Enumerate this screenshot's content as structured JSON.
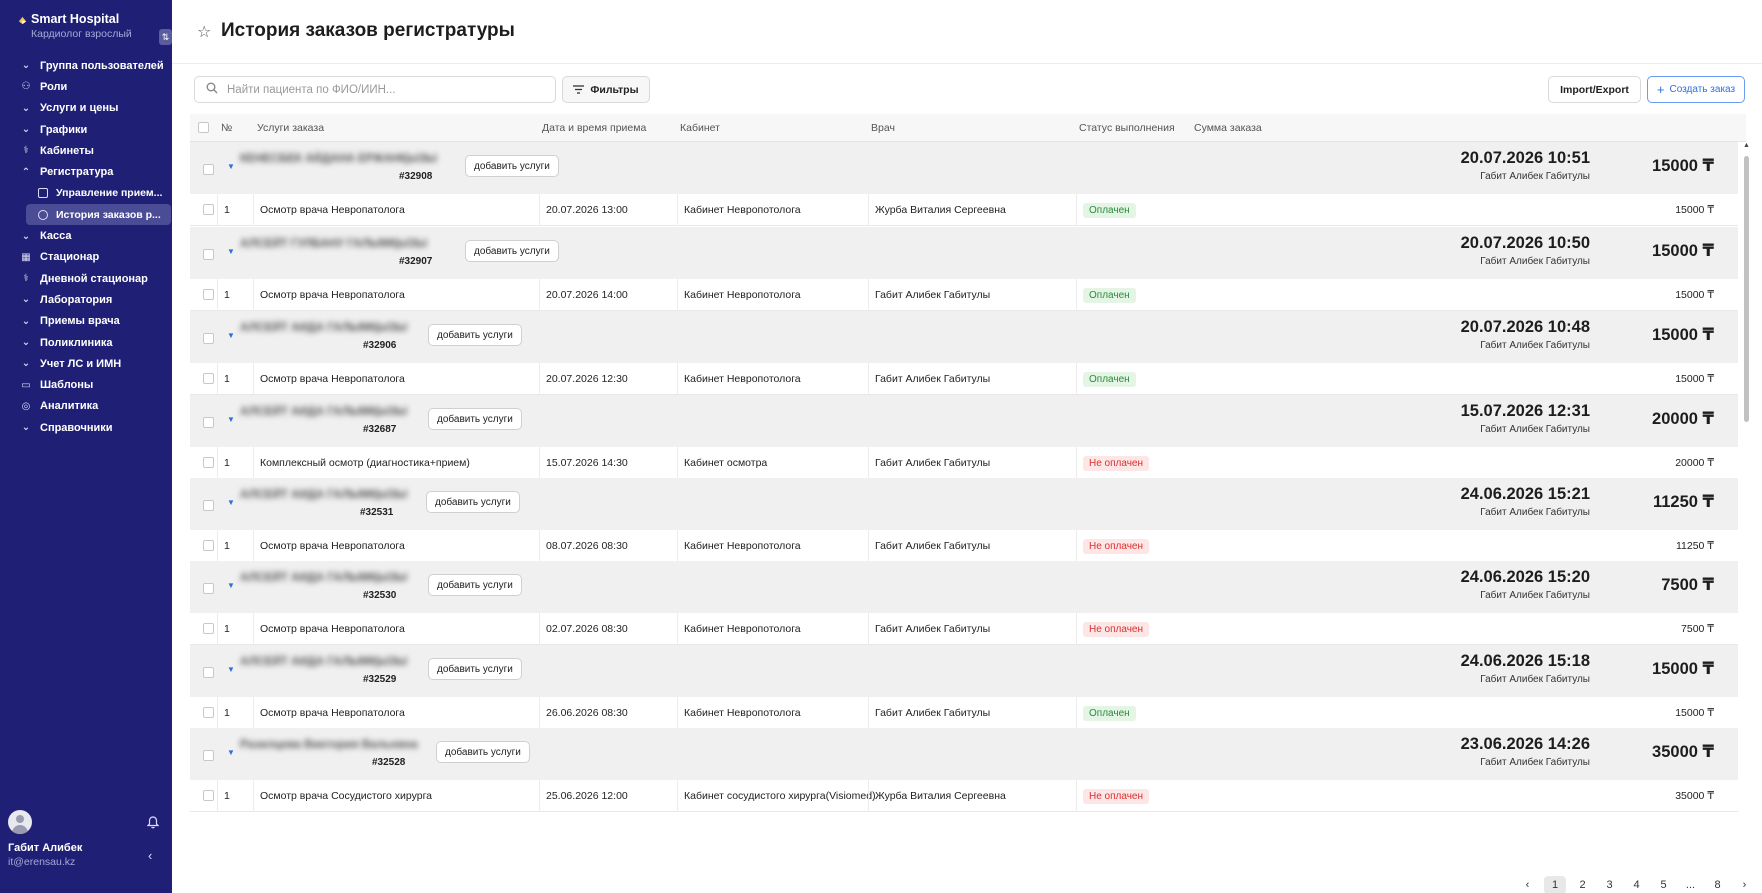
{
  "app": {
    "name": "Smart Hospital",
    "role": "Кардиолог взрослый"
  },
  "sidebar": {
    "items": [
      {
        "label": "Группа пользователей",
        "icon": "chevron-down-icon"
      },
      {
        "label": "Роли",
        "icon": "users-icon"
      },
      {
        "label": "Услуги и цены",
        "icon": "chevron-down-icon"
      },
      {
        "label": "Графики",
        "icon": "chevron-down-icon"
      },
      {
        "label": "Кабинеты",
        "icon": "stethoscope-icon"
      },
      {
        "label": "Регистратура",
        "icon": "chevron-up-icon"
      }
    ],
    "subitems": [
      {
        "label": "Управление прием...",
        "icon": "square-icon"
      },
      {
        "label": "История заказов р...",
        "icon": "circle-icon"
      }
    ],
    "items_after": [
      {
        "label": "Касса",
        "icon": "chevron-down-icon"
      },
      {
        "label": "Стационар",
        "icon": "building-icon"
      },
      {
        "label": "Дневной стационар",
        "icon": "stethoscope-icon"
      },
      {
        "label": "Лаборатория",
        "icon": "chevron-down-icon"
      },
      {
        "label": "Приемы врача",
        "icon": "chevron-down-icon"
      },
      {
        "label": "Поликлиника",
        "icon": "chevron-down-icon"
      },
      {
        "label": "Учет ЛС и ИМН",
        "icon": "chevron-down-icon"
      },
      {
        "label": "Шаблоны",
        "icon": "folder-icon"
      },
      {
        "label": "Аналитика",
        "icon": "chart-icon"
      },
      {
        "label": "Справочники",
        "icon": "chevron-down-icon"
      }
    ]
  },
  "user": {
    "name": "Габит Алибек",
    "email": "it@erensau.kz"
  },
  "header": {
    "title": "История заказов регистратуры"
  },
  "toolbar": {
    "search_placeholder": "Найти пациента по ФИО/ИИН...",
    "filters_label": "Фильтры",
    "import_label": "Import/Export",
    "create_label": "Создать заказ"
  },
  "table": {
    "columns": [
      "№",
      "Услуги заказа",
      "Дата и время приема",
      "Кабинет",
      "Врач",
      "Статус выполнения",
      "Сумма заказа"
    ],
    "add_services_label": "добавить услуги",
    "orders": [
      {
        "patient": "КЕНЕСБЕК АЙДАНА ЕРЖАНҚЫЗЫ",
        "number": "#32908",
        "created": "20.07.2026 10:51",
        "creator": "Габит Алибек Габитулы",
        "total": "15000 ₸",
        "row": {
          "n": "1",
          "service": "Осмотр врача Невропатолога",
          "datetime": "20.07.2026 13:00",
          "room": "Кабинет Невропотолога",
          "doctor": "Журба Виталия Сергеевна",
          "status": "Оплачен",
          "paid": true,
          "sum": "15000 ₸"
        }
      },
      {
        "patient": "АЛСЕЙТ ГУЛБАНУ ГАЛЫМҚЫЗЫ",
        "number": "#32907",
        "created": "20.07.2026 10:50",
        "creator": "Габит Алибек Габитулы",
        "total": "15000 ₸",
        "row": {
          "n": "1",
          "service": "Осмотр врача Невропатолога",
          "datetime": "20.07.2026 14:00",
          "room": "Кабинет Невропотолога",
          "doctor": "Габит Алибек Габитулы",
          "status": "Оплачен",
          "paid": true,
          "sum": "15000 ₸"
        }
      },
      {
        "patient": "АЛСЕЙТ АИДА ГАЛЫМҚЫЗЫ",
        "number": "#32906",
        "created": "20.07.2026 10:48",
        "creator": "Габит Алибек Габитулы",
        "total": "15000 ₸",
        "row": {
          "n": "1",
          "service": "Осмотр врача Невропатолога",
          "datetime": "20.07.2026 12:30",
          "room": "Кабинет Невропотолога",
          "doctor": "Габит Алибек Габитулы",
          "status": "Оплачен",
          "paid": true,
          "sum": "15000 ₸"
        }
      },
      {
        "patient": "АЛСЕЙТ АИДА ГАЛЫМҚЫЗЫ",
        "number": "#32687",
        "created": "15.07.2026 12:31",
        "creator": "Габит Алибек Габитулы",
        "total": "20000 ₸",
        "row": {
          "n": "1",
          "service": "Комплексный осмотр (диагностика+прием)",
          "datetime": "15.07.2026 14:30",
          "room": "Кабинет осмотра",
          "doctor": "Габит Алибек Габитулы",
          "status": "Не оплачен",
          "paid": false,
          "sum": "20000 ₸"
        }
      },
      {
        "patient": "АЛСЕЙТ АИДА ГАЛЫМҚЫЗЫ",
        "number": "#32531",
        "created": "24.06.2026 15:21",
        "creator": "Габит Алибек Габитулы",
        "total": "11250 ₸",
        "row": {
          "n": "1",
          "service": "Осмотр врача Невропатолога",
          "datetime": "08.07.2026 08:30",
          "room": "Кабинет Невропотолога",
          "doctor": "Габит Алибек Габитулы",
          "status": "Не оплачен",
          "paid": false,
          "sum": "11250 ₸"
        }
      },
      {
        "patient": "АЛСЕЙТ АИДА ГАЛЫМҚЫЗЫ",
        "number": "#32530",
        "created": "24.06.2026 15:20",
        "creator": "Габит Алибек Габитулы",
        "total": "7500 ₸",
        "row": {
          "n": "1",
          "service": "Осмотр врача Невропатолога",
          "datetime": "02.07.2026 08:30",
          "room": "Кабинет Невропотолога",
          "doctor": "Габит Алибек Габитулы",
          "status": "Не оплачен",
          "paid": false,
          "sum": "7500 ₸"
        }
      },
      {
        "patient": "АЛСЕЙТ АИДА ГАЛЫМҚЫЗЫ",
        "number": "#32529",
        "created": "24.06.2026 15:18",
        "creator": "Габит Алибек Габитулы",
        "total": "15000 ₸",
        "row": {
          "n": "1",
          "service": "Осмотр врача Невропатолога",
          "datetime": "26.06.2026 08:30",
          "room": "Кабинет Невропотолога",
          "doctor": "Габит Алибек Габитулы",
          "status": "Оплачен",
          "paid": true,
          "sum": "15000 ₸"
        }
      },
      {
        "patient": "Разилцева Виктория Вальевна",
        "number": "#32528",
        "created": "23.06.2026 14:26",
        "creator": "Габит Алибек Габитулы",
        "total": "35000 ₸",
        "row": {
          "n": "1",
          "service": "Осмотр врача Сосудистого хирурга",
          "datetime": "25.06.2026 12:00",
          "room": "Кабинет сосудистого хирурга(Visiomed)",
          "doctor": "Журба Виталия Сергеевна",
          "status": "Не оплачен",
          "paid": false,
          "sum": "35000 ₸"
        }
      }
    ]
  },
  "pagination": {
    "pages": [
      "1",
      "2",
      "3",
      "4",
      "5",
      "...",
      "8"
    ],
    "current": "1"
  },
  "colors": {
    "sidebar_bg": "#1f2075",
    "accent": "#2f6fe0",
    "paid": "#2a8a3b",
    "unpaid": "#d93030"
  }
}
